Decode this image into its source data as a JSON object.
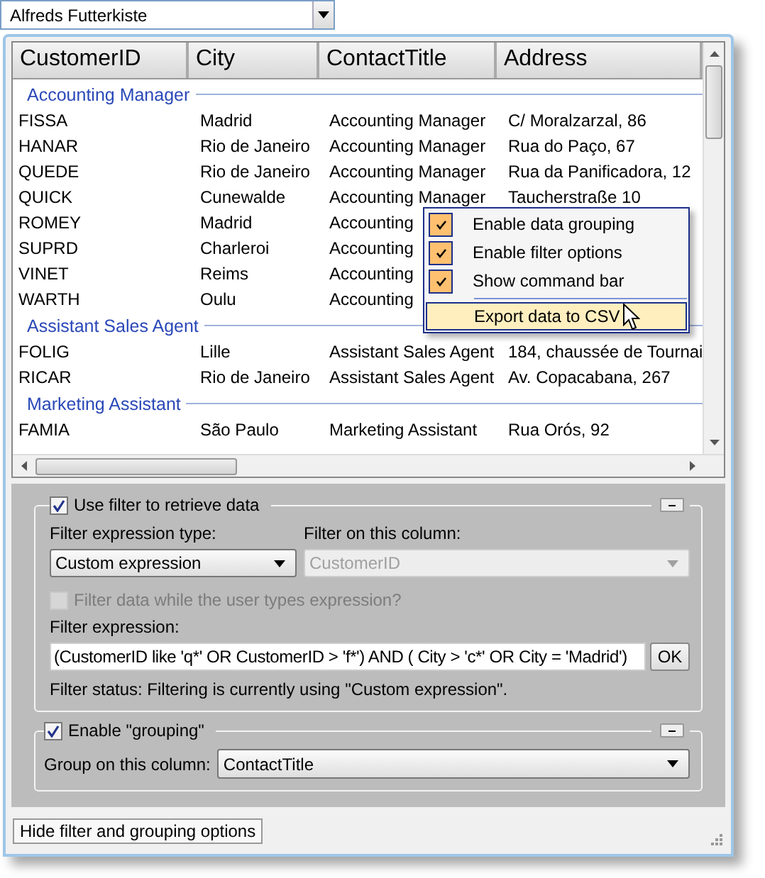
{
  "combo": {
    "value": "Alfreds Futterkiste"
  },
  "grid": {
    "columns": [
      "CustomerID",
      "City",
      "ContactTitle",
      "Address"
    ],
    "groups": [
      {
        "title": "Accounting Manager",
        "rows": [
          [
            "FISSA",
            "Madrid",
            "Accounting Manager",
            "C/ Moralzarzal, 86"
          ],
          [
            "HANAR",
            "Rio de Janeiro",
            "Accounting Manager",
            "Rua do Paço, 67"
          ],
          [
            "QUEDE",
            "Rio de Janeiro",
            "Accounting Manager",
            "Rua da Panificadora, 12"
          ],
          [
            "QUICK",
            "Cunewalde",
            "Accounting Manager",
            "Taucherstraße 10"
          ],
          [
            "ROMEY",
            "Madrid",
            "Accounting"
          ],
          [
            "SUPRD",
            "Charleroi",
            "Accounting"
          ],
          [
            "VINET",
            "Reims",
            "Accounting"
          ],
          [
            "WARTH",
            "Oulu",
            "Accounting"
          ]
        ]
      },
      {
        "title": "Assistant Sales Agent",
        "rows": [
          [
            "FOLIG",
            "Lille",
            "Assistant Sales Agent",
            "184, chaussée de Tournai"
          ],
          [
            "RICAR",
            "Rio de Janeiro",
            "Assistant Sales Agent",
            "Av. Copacabana, 267"
          ]
        ]
      },
      {
        "title": "Marketing Assistant",
        "rows": [
          [
            "FAMIA",
            "São Paulo",
            "Marketing Assistant",
            "Rua Orós, 92"
          ]
        ]
      }
    ]
  },
  "context_menu": {
    "items": [
      {
        "kind": "check",
        "label": "Enable data grouping",
        "checked": true
      },
      {
        "kind": "check",
        "label": "Enable filter options",
        "checked": true
      },
      {
        "kind": "check",
        "label": "Show command bar",
        "checked": true
      },
      {
        "kind": "separator"
      },
      {
        "kind": "action",
        "label": "Export data to CSV",
        "selected": true
      }
    ]
  },
  "filter": {
    "title": "Use filter to retrieve data",
    "enabled": true,
    "type_label": "Filter expression type:",
    "type_value": "Custom expression",
    "column_label": "Filter on this column:",
    "column_value": "CustomerID",
    "column_disabled": true,
    "live_filter": {
      "label": "Filter data while the user types expression?",
      "checked": false,
      "disabled": true
    },
    "expression_label": "Filter expression:",
    "expression": "(CustomerID like 'q*' OR CustomerID > 'f*') AND ( City > 'c*' OR City = 'Madrid')",
    "ok": "OK",
    "status": "Filter status: Filtering is currently using \"Custom expression\"."
  },
  "grouping": {
    "title": "Enable \"grouping\"",
    "enabled": true,
    "label": "Group on this column:",
    "value": "ContactTitle"
  },
  "status_bar": {
    "button": "Hide filter and grouping options"
  }
}
